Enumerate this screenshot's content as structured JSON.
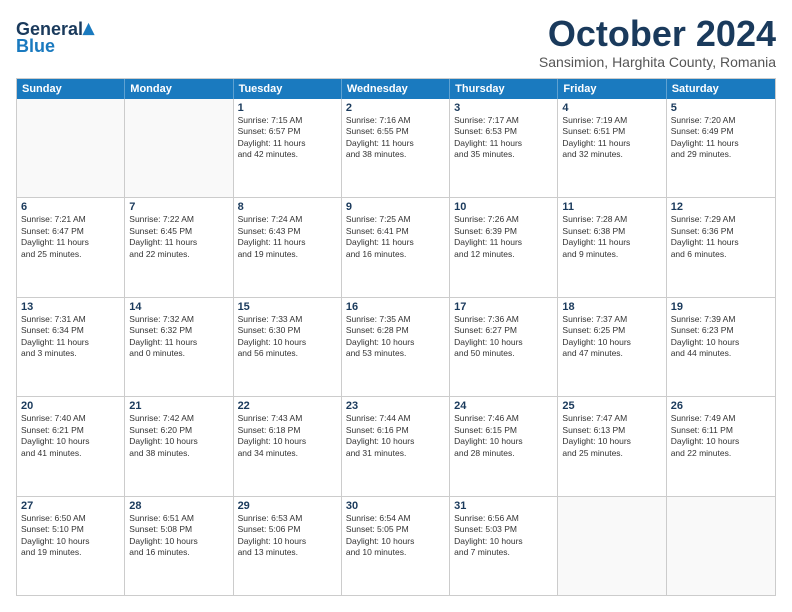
{
  "logo": {
    "line1": "General",
    "line2": "Blue"
  },
  "title": "October 2024",
  "subtitle": "Sansimion, Harghita County, Romania",
  "header_days": [
    "Sunday",
    "Monday",
    "Tuesday",
    "Wednesday",
    "Thursday",
    "Friday",
    "Saturday"
  ],
  "rows": [
    [
      {
        "day": "",
        "lines": []
      },
      {
        "day": "",
        "lines": []
      },
      {
        "day": "1",
        "lines": [
          "Sunrise: 7:15 AM",
          "Sunset: 6:57 PM",
          "Daylight: 11 hours",
          "and 42 minutes."
        ]
      },
      {
        "day": "2",
        "lines": [
          "Sunrise: 7:16 AM",
          "Sunset: 6:55 PM",
          "Daylight: 11 hours",
          "and 38 minutes."
        ]
      },
      {
        "day": "3",
        "lines": [
          "Sunrise: 7:17 AM",
          "Sunset: 6:53 PM",
          "Daylight: 11 hours",
          "and 35 minutes."
        ]
      },
      {
        "day": "4",
        "lines": [
          "Sunrise: 7:19 AM",
          "Sunset: 6:51 PM",
          "Daylight: 11 hours",
          "and 32 minutes."
        ]
      },
      {
        "day": "5",
        "lines": [
          "Sunrise: 7:20 AM",
          "Sunset: 6:49 PM",
          "Daylight: 11 hours",
          "and 29 minutes."
        ]
      }
    ],
    [
      {
        "day": "6",
        "lines": [
          "Sunrise: 7:21 AM",
          "Sunset: 6:47 PM",
          "Daylight: 11 hours",
          "and 25 minutes."
        ]
      },
      {
        "day": "7",
        "lines": [
          "Sunrise: 7:22 AM",
          "Sunset: 6:45 PM",
          "Daylight: 11 hours",
          "and 22 minutes."
        ]
      },
      {
        "day": "8",
        "lines": [
          "Sunrise: 7:24 AM",
          "Sunset: 6:43 PM",
          "Daylight: 11 hours",
          "and 19 minutes."
        ]
      },
      {
        "day": "9",
        "lines": [
          "Sunrise: 7:25 AM",
          "Sunset: 6:41 PM",
          "Daylight: 11 hours",
          "and 16 minutes."
        ]
      },
      {
        "day": "10",
        "lines": [
          "Sunrise: 7:26 AM",
          "Sunset: 6:39 PM",
          "Daylight: 11 hours",
          "and 12 minutes."
        ]
      },
      {
        "day": "11",
        "lines": [
          "Sunrise: 7:28 AM",
          "Sunset: 6:38 PM",
          "Daylight: 11 hours",
          "and 9 minutes."
        ]
      },
      {
        "day": "12",
        "lines": [
          "Sunrise: 7:29 AM",
          "Sunset: 6:36 PM",
          "Daylight: 11 hours",
          "and 6 minutes."
        ]
      }
    ],
    [
      {
        "day": "13",
        "lines": [
          "Sunrise: 7:31 AM",
          "Sunset: 6:34 PM",
          "Daylight: 11 hours",
          "and 3 minutes."
        ]
      },
      {
        "day": "14",
        "lines": [
          "Sunrise: 7:32 AM",
          "Sunset: 6:32 PM",
          "Daylight: 11 hours",
          "and 0 minutes."
        ]
      },
      {
        "day": "15",
        "lines": [
          "Sunrise: 7:33 AM",
          "Sunset: 6:30 PM",
          "Daylight: 10 hours",
          "and 56 minutes."
        ]
      },
      {
        "day": "16",
        "lines": [
          "Sunrise: 7:35 AM",
          "Sunset: 6:28 PM",
          "Daylight: 10 hours",
          "and 53 minutes."
        ]
      },
      {
        "day": "17",
        "lines": [
          "Sunrise: 7:36 AM",
          "Sunset: 6:27 PM",
          "Daylight: 10 hours",
          "and 50 minutes."
        ]
      },
      {
        "day": "18",
        "lines": [
          "Sunrise: 7:37 AM",
          "Sunset: 6:25 PM",
          "Daylight: 10 hours",
          "and 47 minutes."
        ]
      },
      {
        "day": "19",
        "lines": [
          "Sunrise: 7:39 AM",
          "Sunset: 6:23 PM",
          "Daylight: 10 hours",
          "and 44 minutes."
        ]
      }
    ],
    [
      {
        "day": "20",
        "lines": [
          "Sunrise: 7:40 AM",
          "Sunset: 6:21 PM",
          "Daylight: 10 hours",
          "and 41 minutes."
        ]
      },
      {
        "day": "21",
        "lines": [
          "Sunrise: 7:42 AM",
          "Sunset: 6:20 PM",
          "Daylight: 10 hours",
          "and 38 minutes."
        ]
      },
      {
        "day": "22",
        "lines": [
          "Sunrise: 7:43 AM",
          "Sunset: 6:18 PM",
          "Daylight: 10 hours",
          "and 34 minutes."
        ]
      },
      {
        "day": "23",
        "lines": [
          "Sunrise: 7:44 AM",
          "Sunset: 6:16 PM",
          "Daylight: 10 hours",
          "and 31 minutes."
        ]
      },
      {
        "day": "24",
        "lines": [
          "Sunrise: 7:46 AM",
          "Sunset: 6:15 PM",
          "Daylight: 10 hours",
          "and 28 minutes."
        ]
      },
      {
        "day": "25",
        "lines": [
          "Sunrise: 7:47 AM",
          "Sunset: 6:13 PM",
          "Daylight: 10 hours",
          "and 25 minutes."
        ]
      },
      {
        "day": "26",
        "lines": [
          "Sunrise: 7:49 AM",
          "Sunset: 6:11 PM",
          "Daylight: 10 hours",
          "and 22 minutes."
        ]
      }
    ],
    [
      {
        "day": "27",
        "lines": [
          "Sunrise: 6:50 AM",
          "Sunset: 5:10 PM",
          "Daylight: 10 hours",
          "and 19 minutes."
        ]
      },
      {
        "day": "28",
        "lines": [
          "Sunrise: 6:51 AM",
          "Sunset: 5:08 PM",
          "Daylight: 10 hours",
          "and 16 minutes."
        ]
      },
      {
        "day": "29",
        "lines": [
          "Sunrise: 6:53 AM",
          "Sunset: 5:06 PM",
          "Daylight: 10 hours",
          "and 13 minutes."
        ]
      },
      {
        "day": "30",
        "lines": [
          "Sunrise: 6:54 AM",
          "Sunset: 5:05 PM",
          "Daylight: 10 hours",
          "and 10 minutes."
        ]
      },
      {
        "day": "31",
        "lines": [
          "Sunrise: 6:56 AM",
          "Sunset: 5:03 PM",
          "Daylight: 10 hours",
          "and 7 minutes."
        ]
      },
      {
        "day": "",
        "lines": []
      },
      {
        "day": "",
        "lines": []
      }
    ]
  ]
}
